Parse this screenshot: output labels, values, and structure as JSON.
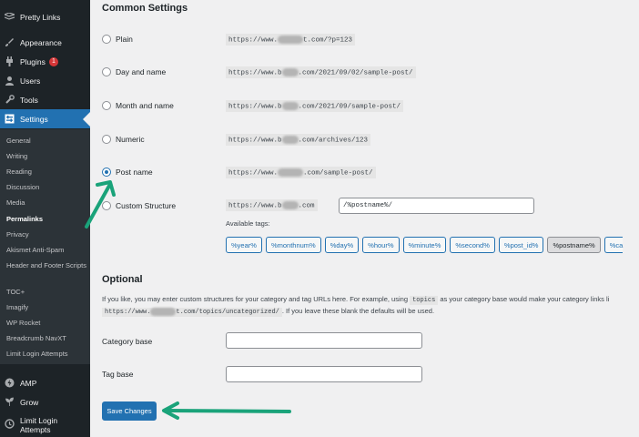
{
  "sidebar": {
    "top_items": [
      {
        "label": "Pretty Links",
        "icon": "pretty-links-icon"
      },
      {
        "label": "Appearance",
        "icon": "paintbrush-icon"
      },
      {
        "label": "Plugins",
        "icon": "plugin-icon",
        "badge": "1"
      },
      {
        "label": "Users",
        "icon": "users-icon"
      },
      {
        "label": "Tools",
        "icon": "wrench-icon"
      },
      {
        "label": "Settings",
        "icon": "settings-icon",
        "active": true
      }
    ],
    "submenu": [
      {
        "label": "General"
      },
      {
        "label": "Writing"
      },
      {
        "label": "Reading"
      },
      {
        "label": "Discussion"
      },
      {
        "label": "Media"
      },
      {
        "label": "Permalinks",
        "current": true
      },
      {
        "label": "Privacy"
      },
      {
        "label": "Akismet Anti-Spam"
      },
      {
        "label": "Header and Footer Scripts"
      },
      {
        "label": "TOC+"
      },
      {
        "label": "Imagify"
      },
      {
        "label": "WP Rocket"
      },
      {
        "label": "Breadcrumb NavXT"
      },
      {
        "label": "Limit Login Attempts"
      }
    ],
    "bottom_items": [
      {
        "label": "AMP",
        "icon": "amp-icon"
      },
      {
        "label": "Grow",
        "icon": "grow-icon"
      },
      {
        "label": "Limit Login Attempts",
        "icon": "limit-login-icon"
      }
    ]
  },
  "common_settings": {
    "heading": "Common Settings",
    "options": [
      {
        "label": "Plain",
        "example_pre": "https://www.",
        "example_post": "t.com/?p=123",
        "checked": false
      },
      {
        "label": "Day and name",
        "example_pre": "https://www.b",
        "example_post": ".com/2021/09/02/sample-post/",
        "checked": false
      },
      {
        "label": "Month and name",
        "example_pre": "https://www.b",
        "example_post": ".com/2021/09/sample-post/",
        "checked": false
      },
      {
        "label": "Numeric",
        "example_pre": "https://www.b",
        "example_post": ".com/archives/123",
        "checked": false
      },
      {
        "label": "Post name",
        "example_pre": "https://www.",
        "example_post": ".com/sample-post/",
        "checked": true
      },
      {
        "label": "Custom Structure",
        "example_pre": "https://www.b",
        "example_post": ".com",
        "checked": false
      }
    ],
    "custom_structure_value": "/%postname%/",
    "available_tags_label": "Available tags:",
    "tags": [
      {
        "label": "%year%"
      },
      {
        "label": "%monthnum%"
      },
      {
        "label": "%day%"
      },
      {
        "label": "%hour%"
      },
      {
        "label": "%minute%"
      },
      {
        "label": "%second%"
      },
      {
        "label": "%post_id%"
      },
      {
        "label": "%postname%",
        "pressed": true
      },
      {
        "label": "%ca"
      }
    ]
  },
  "optional": {
    "heading": "Optional",
    "desc_line1_pre": "If you like, you may enter custom structures for your category and tag URLs here. For example, using",
    "desc_code": "topics",
    "desc_line1_post": "as your category base would make your category links li",
    "desc_url_pre": "https://www.",
    "desc_url_post": "t.com/topics/uncategorized/",
    "desc_line2_post": ". If you leave these blank the defaults will be used.",
    "category_base_label": "Category base",
    "category_base_value": "",
    "tag_base_label": "Tag base",
    "tag_base_value": ""
  },
  "save_button_label": "Save Changes",
  "annotation_color": "#1aa37a"
}
